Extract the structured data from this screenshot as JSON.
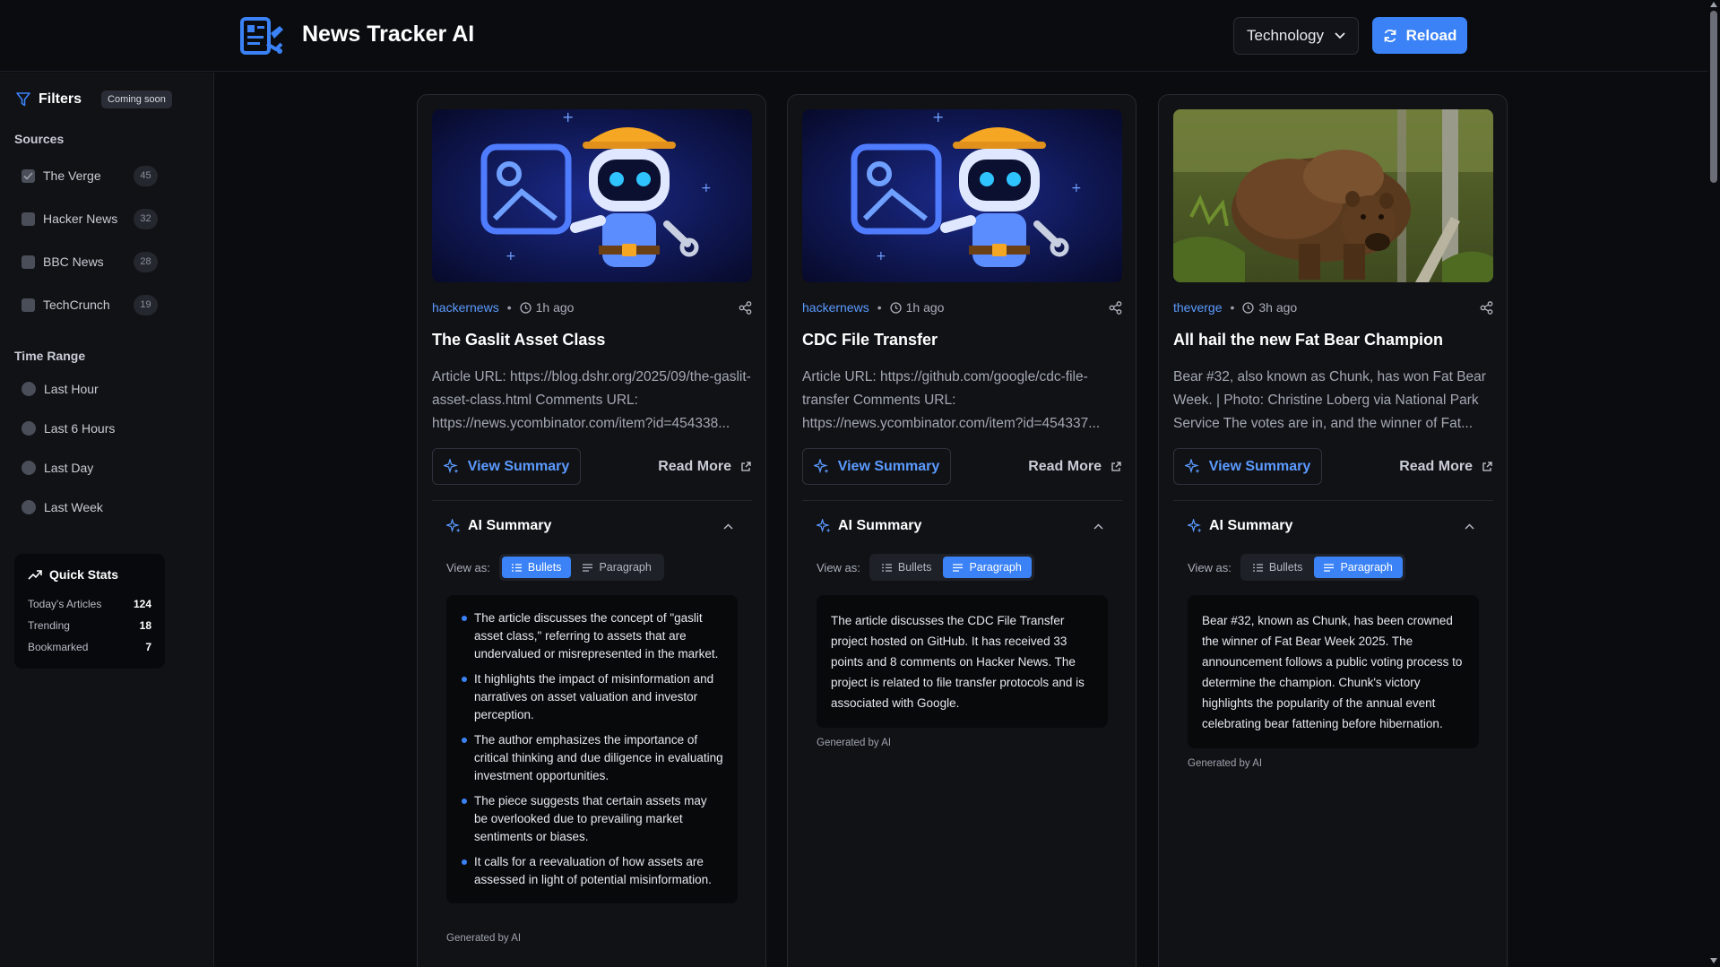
{
  "header": {
    "title": "News Tracker AI",
    "category": "Technology",
    "reload_label": "Reload"
  },
  "sidebar": {
    "filters_label": "Filters",
    "filters_badge": "Coming soon",
    "sources_label": "Sources",
    "sources": [
      {
        "name": "The Verge",
        "count": "45",
        "checked": true
      },
      {
        "name": "Hacker News",
        "count": "32",
        "checked": false
      },
      {
        "name": "BBC News",
        "count": "28",
        "checked": false
      },
      {
        "name": "TechCrunch",
        "count": "19",
        "checked": false
      }
    ],
    "time_range_label": "Time Range",
    "time_ranges": [
      "Last Hour",
      "Last 6 Hours",
      "Last Day",
      "Last Week"
    ],
    "quick_stats": {
      "title": "Quick Stats",
      "rows": [
        {
          "label": "Today's Articles",
          "value": "124"
        },
        {
          "label": "Trending",
          "value": "18"
        },
        {
          "label": "Bookmarked",
          "value": "7"
        }
      ]
    }
  },
  "colors": {
    "accent": "#3a82f6",
    "link": "#5b9bff",
    "background": "#0b0c10",
    "card": "#111216"
  },
  "articles": [
    {
      "source": "hackernews",
      "time": "1h ago",
      "title": "The Gaslit Asset Class",
      "description": "Article URL: https://blog.dshr.org/2025/09/the-gaslit-asset-class.html Comments URL: https://news.ycombinator.com/item?id=454338...",
      "image": "robot-placeholder",
      "view_summary_label": "View Summary",
      "read_more_label": "Read More",
      "ai_summary_label": "AI Summary",
      "view_as_label": "View as:",
      "bullets_label": "Bullets",
      "paragraph_label": "Paragraph",
      "mode": "bullets",
      "summary_bullets": [
        "The article discusses the concept of \"gaslit asset class,\" referring to assets that are undervalued or misrepresented in the market.",
        "It highlights the impact of misinformation and narratives on asset valuation and investor perception.",
        "The author emphasizes the importance of critical thinking and due diligence in evaluating investment opportunities.",
        "The piece suggests that certain assets may be overlooked due to prevailing market sentiments or biases.",
        "It calls for a reevaluation of how assets are assessed in light of potential misinformation."
      ],
      "generated_label": "Generated by AI"
    },
    {
      "source": "hackernews",
      "time": "1h ago",
      "title": "CDC File Transfer",
      "description": "Article URL: https://github.com/google/cdc-file-transfer Comments URL: https://news.ycombinator.com/item?id=454337...",
      "image": "robot-placeholder",
      "view_summary_label": "View Summary",
      "read_more_label": "Read More",
      "ai_summary_label": "AI Summary",
      "view_as_label": "View as:",
      "bullets_label": "Bullets",
      "paragraph_label": "Paragraph",
      "mode": "paragraph",
      "summary_paragraph": "The article discusses the CDC File Transfer project hosted on GitHub. It has received 33 points and 8 comments on Hacker News. The project is related to file transfer protocols and is associated with Google.",
      "generated_label": "Generated by AI"
    },
    {
      "source": "theverge",
      "time": "3h ago",
      "title": "All hail the new Fat Bear Champion",
      "description": "Bear #32, also known as Chunk, has won Fat Bear Week. | Photo: Christine Loberg via National Park Service The votes are in, and the winner of Fat...",
      "image": "bear-photo",
      "view_summary_label": "View Summary",
      "read_more_label": "Read More",
      "ai_summary_label": "AI Summary",
      "view_as_label": "View as:",
      "bullets_label": "Bullets",
      "paragraph_label": "Paragraph",
      "mode": "paragraph",
      "summary_paragraph": "Bear #32, known as Chunk, has been crowned the winner of Fat Bear Week 2025. The announcement follows a public voting process to determine the champion. Chunk's victory highlights the popularity of the annual event celebrating bear fattening before hibernation.",
      "generated_label": "Generated by AI"
    }
  ]
}
